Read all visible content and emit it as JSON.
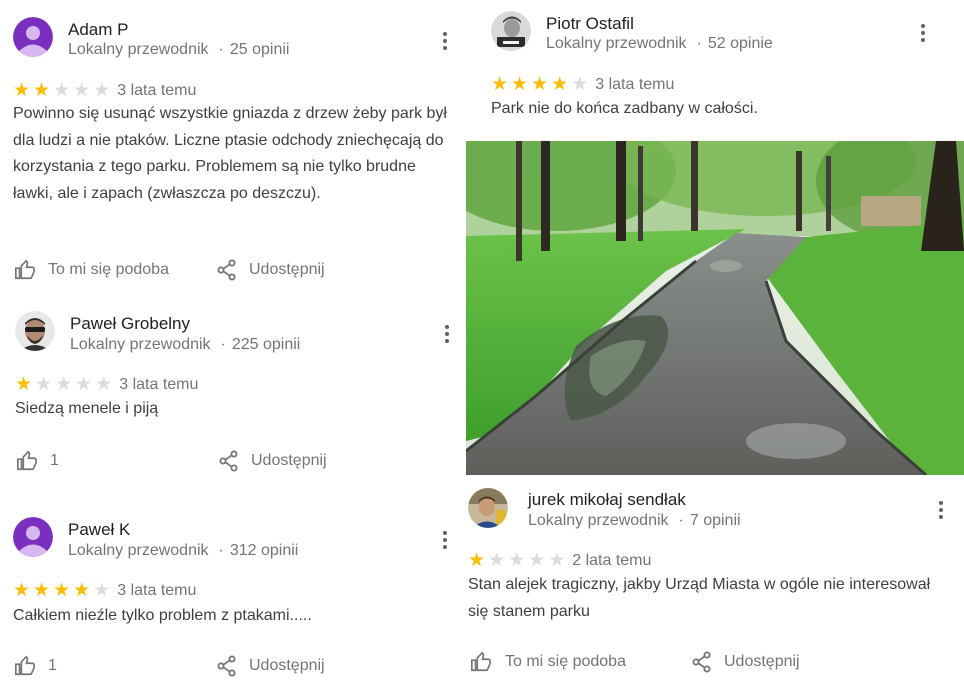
{
  "reviews": [
    {
      "author": "Adam P",
      "meta_role": "Lokalny przewodnik",
      "meta_count": "25 opinii",
      "rating": 2,
      "date": "3 lata temu",
      "text": "Powinno się usunąć wszystkie gniazda z drzew żeby park był dla ludzi a nie ptaków. Liczne ptasie odchody zniechęcają do korzystania z tego parku. Problemem są nie tylko brudne ławki, ale i zapach (zwłaszcza po deszczu).",
      "like_label": "To mi się podoba",
      "share_label": "Udostępnij",
      "avatar_color": "#7b2fbe"
    },
    {
      "author": "Paweł Grobelny",
      "meta_role": "Lokalny przewodnik",
      "meta_count": "225 opinii",
      "rating": 1,
      "date": "3 lata temu",
      "text": "Siedzą menele i piją",
      "like_label": "1",
      "share_label": "Udostępnij"
    },
    {
      "author": "Paweł K",
      "meta_role": "Lokalny przewodnik",
      "meta_count": "312 opinii",
      "rating": 4,
      "date": "3 lata temu",
      "text": "Całkiem nieźle tylko problem z ptakami.....",
      "like_label": "1",
      "share_label": "Udostępnij",
      "avatar_color": "#7b2fbe"
    },
    {
      "author": "Piotr Ostafil",
      "meta_role": "Lokalny przewodnik",
      "meta_count": "52 opinie",
      "rating": 4,
      "date": "3 lata temu",
      "text": "Park nie do końca zadbany w całości."
    },
    {
      "author": "jurek mikołaj sendłak",
      "meta_role": "Lokalny przewodnik",
      "meta_count": "7 opinii",
      "rating": 1,
      "date": "2 lata temu",
      "text": "Stan alejek tragiczny, jakby Urząd Miasta w ogóle nie interesował się stanem parku",
      "like_label": "To mi się podoba",
      "share_label": "Udostępnij"
    }
  ],
  "colors": {
    "star_on": "#fbbc04",
    "star_off": "#dadce0",
    "secondary_text": "#70757a",
    "body_text": "#3c4043"
  },
  "icons": [
    "more-vert-icon",
    "thumb-up-icon",
    "share-icon",
    "star-icon"
  ]
}
